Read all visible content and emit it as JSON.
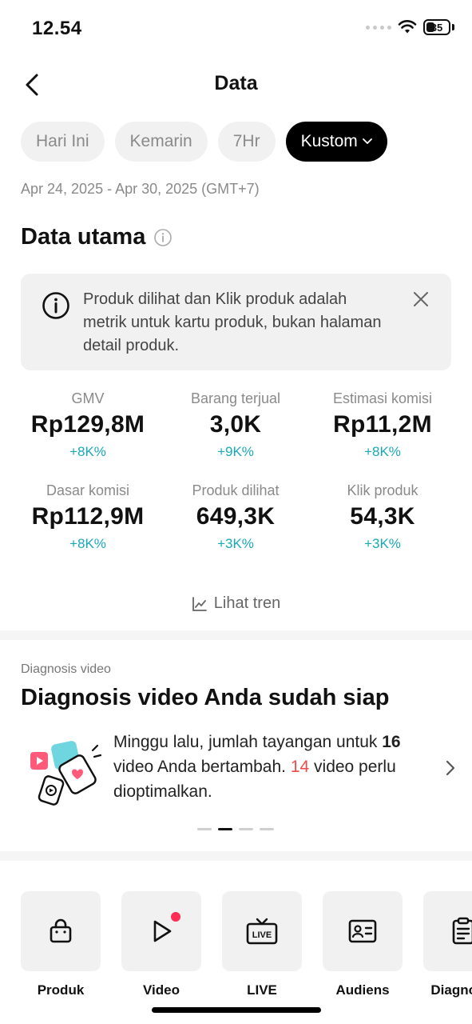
{
  "status": {
    "time": "12.54",
    "battery": "35"
  },
  "nav": {
    "title": "Data"
  },
  "chips": [
    {
      "label": "Hari Ini"
    },
    {
      "label": "Kemarin"
    },
    {
      "label": "7Hr"
    },
    {
      "label": "Kustom"
    }
  ],
  "date_range": "Apr 24, 2025 - Apr 30, 2025 (GMT+7)",
  "main_section": {
    "title": "Data utama"
  },
  "notice": {
    "text": "Produk dilihat dan Klik produk adalah metrik untuk kartu produk, bukan halaman detail produk."
  },
  "metrics": [
    {
      "label": "GMV",
      "value": "Rp129,8M",
      "change": "+8K%"
    },
    {
      "label": "Barang terjual",
      "value": "3,0K",
      "change": "+9K%"
    },
    {
      "label": "Estimasi komisi",
      "value": "Rp11,2M",
      "change": "+8K%"
    },
    {
      "label": "Dasar komisi",
      "value": "Rp112,9M",
      "change": "+8K%"
    },
    {
      "label": "Produk dilihat",
      "value": "649,3K",
      "change": "+3K%"
    },
    {
      "label": "Klik produk",
      "value": "54,3K",
      "change": "+3K%"
    }
  ],
  "trend_link": "Lihat tren",
  "diagnosis": {
    "small_label": "Diagnosis video",
    "title": "Diagnosis video Anda sudah siap",
    "text_part1": "Minggu lalu, jumlah tayangan untuk ",
    "count_videos": "16",
    "text_part2": " video Anda bertambah. ",
    "count_optimize": "14",
    "text_part3": " video perlu dioptimalkan."
  },
  "pager": {
    "count": 4,
    "active_index": 1
  },
  "tools": [
    {
      "label": "Produk",
      "icon": "shopping-bag-icon"
    },
    {
      "label": "Video",
      "icon": "play-icon"
    },
    {
      "label": "LIVE",
      "icon": "live-tv-icon"
    },
    {
      "label": "Audiens",
      "icon": "id-card-icon"
    },
    {
      "label": "Diagnosis",
      "icon": "clipboard-icon"
    }
  ],
  "colors": {
    "accent_teal": "#1aa8b8",
    "highlight_red": "#ef4b4b",
    "notification_dot": "#ff2d55"
  }
}
